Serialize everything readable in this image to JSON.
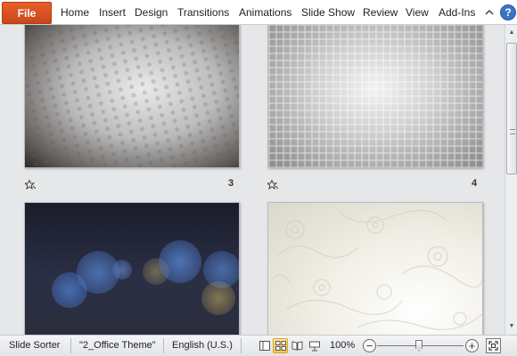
{
  "ribbon": {
    "file_label": "File",
    "tabs": [
      {
        "label": "Home"
      },
      {
        "label": "Insert"
      },
      {
        "label": "Design"
      },
      {
        "label": "Transitions"
      },
      {
        "label": "Animations"
      },
      {
        "label": "Slide Show"
      },
      {
        "label": "Review"
      },
      {
        "label": "View"
      },
      {
        "label": "Add-Ins"
      }
    ],
    "minimize_icon": "chevron-up-icon",
    "help_label": "?"
  },
  "slides": [
    {
      "number": "3",
      "has_animation_icon": true,
      "style": "dark-vignette-dots"
    },
    {
      "number": "4",
      "has_animation_icon": true,
      "style": "silver-grid"
    },
    {
      "number": "",
      "style": "dark-bokeh"
    },
    {
      "number": "",
      "style": "cream-floral"
    }
  ],
  "status_bar": {
    "view_name": "Slide Sorter",
    "theme": "\"2_Office Theme\"",
    "language": "English (U.S.)",
    "zoom": "100%",
    "zoom_out_label": "−",
    "zoom_in_label": "+",
    "active_view": "slide-sorter"
  },
  "colors": {
    "file_tab": "#d4521f",
    "sorter_bg": "#e6e7e9",
    "active_view": "#f7c54c",
    "help": "#3d73c2"
  }
}
